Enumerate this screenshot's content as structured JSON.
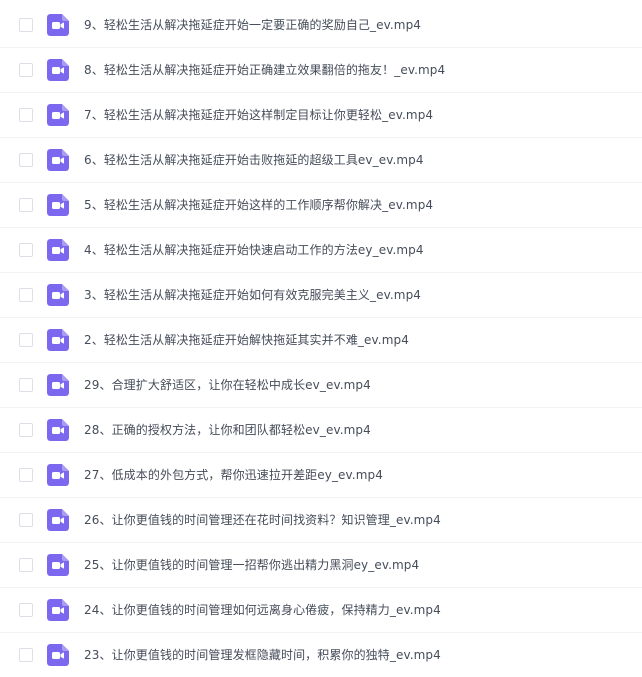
{
  "colors": {
    "icon_bg": "#7b68ee",
    "icon_fold": "#a99cf5",
    "text": "#454d5a",
    "divider": "#f2f3f5",
    "checkbox_border": "#dcdfe6"
  },
  "files": [
    {
      "name": "9、轻松生活从解决拖延症开始一定要正确的奖励自己_ev.mp4",
      "icon": "video-file-icon",
      "checked": false
    },
    {
      "name": "8、轻松生活从解决拖延症开始正确建立效果翻倍的拖友！_ev.mp4",
      "icon": "video-file-icon",
      "checked": false
    },
    {
      "name": "7、轻松生活从解决拖延症开始这样制定目标让你更轻松_ev.mp4",
      "icon": "video-file-icon",
      "checked": false
    },
    {
      "name": "6、轻松生活从解决拖延症开始击败拖延的超级工具ev_ev.mp4",
      "icon": "video-file-icon",
      "checked": false
    },
    {
      "name": "5、轻松生活从解决拖延症开始这样的工作顺序帮你解决_ev.mp4",
      "icon": "video-file-icon",
      "checked": false
    },
    {
      "name": "4、轻松生活从解决拖延症开始快速启动工作的方法ey_ev.mp4",
      "icon": "video-file-icon",
      "checked": false
    },
    {
      "name": "3、轻松生活从解决拖延症开始如何有效克服完美主义_ev.mp4",
      "icon": "video-file-icon",
      "checked": false
    },
    {
      "name": "2、轻松生活从解决拖延症开始解快拖延其实并不难_ev.mp4",
      "icon": "video-file-icon",
      "checked": false
    },
    {
      "name": "29、合理扩大舒适区，让你在轻松中成长ev_ev.mp4",
      "icon": "video-file-icon",
      "checked": false
    },
    {
      "name": "28、正确的授权方法，让你和团队都轻松ev_ev.mp4",
      "icon": "video-file-icon",
      "checked": false
    },
    {
      "name": "27、低成本的外包方式，帮你迅速拉开差距ey_ev.mp4",
      "icon": "video-file-icon",
      "checked": false
    },
    {
      "name": "26、让你更值钱的时间管理还在花时间找资料？知识管理_ev.mp4",
      "icon": "video-file-icon",
      "checked": false
    },
    {
      "name": "25、让你更值钱的时间管理一招帮你逃出精力黑洞ey_ev.mp4",
      "icon": "video-file-icon",
      "checked": false
    },
    {
      "name": "24、让你更值钱的时间管理如何远离身心倦疲，保持精力_ev.mp4",
      "icon": "video-file-icon",
      "checked": false
    },
    {
      "name": "23、让你更值钱的时间管理发框隐藏时间，积累你的独特_ev.mp4",
      "icon": "video-file-icon",
      "checked": false
    }
  ]
}
